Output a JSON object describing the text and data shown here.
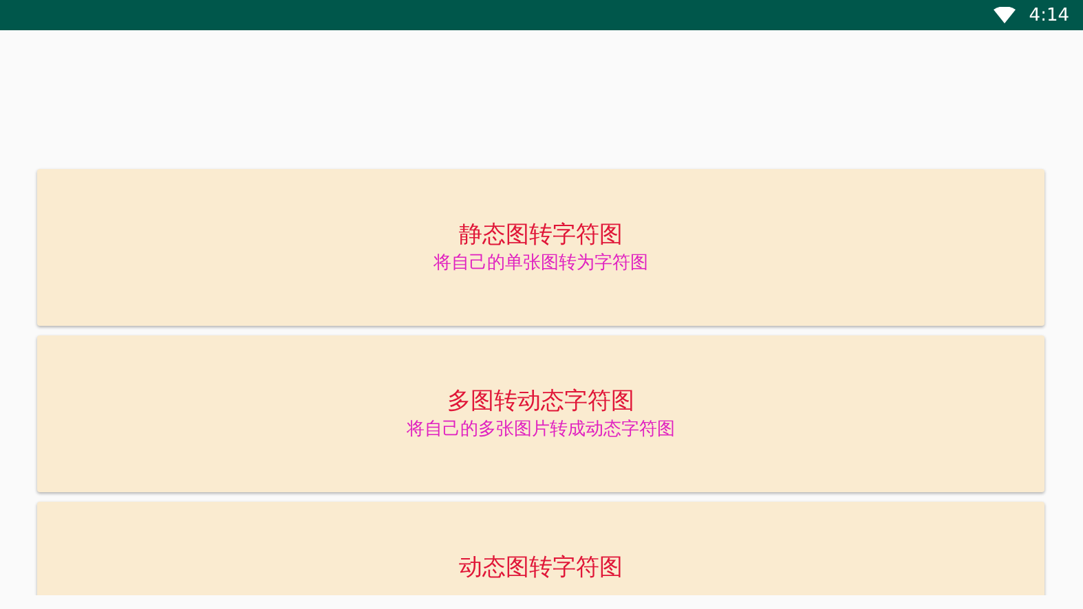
{
  "status_bar": {
    "time": "4:14"
  },
  "cards": [
    {
      "title": "静态图转字符图",
      "subtitle": "将自己的单张图转为字符图"
    },
    {
      "title": "多图转动态字符图",
      "subtitle": "将自己的多张图片转成动态字符图"
    },
    {
      "title": "动态图转字符图"
    }
  ]
}
